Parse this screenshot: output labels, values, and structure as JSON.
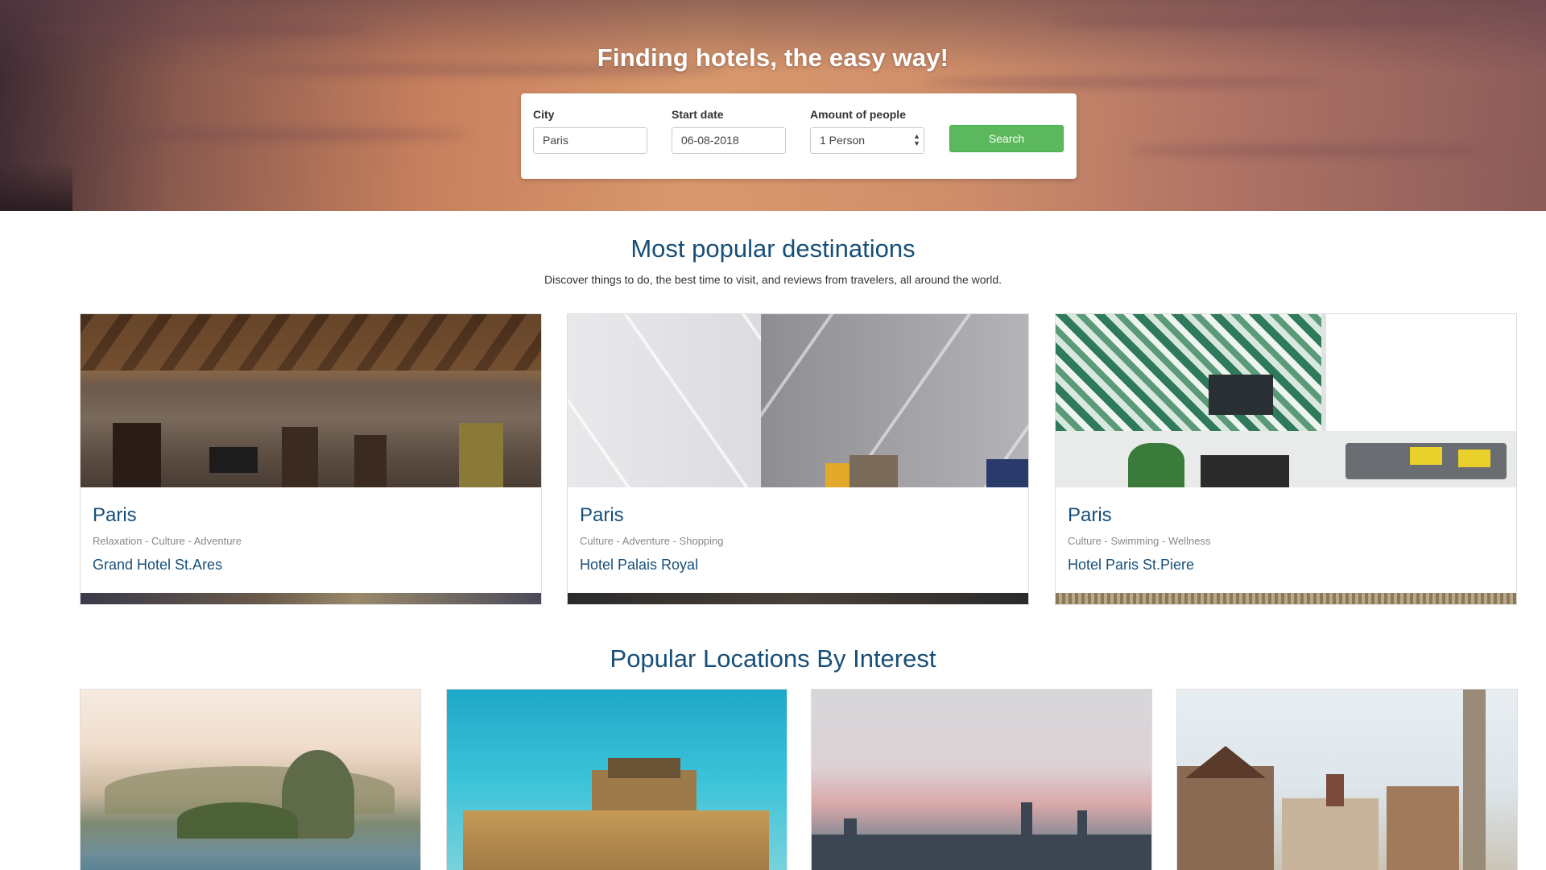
{
  "hero": {
    "title": "Finding hotels, the easy way!",
    "search": {
      "city_label": "City",
      "city_value": "Paris",
      "date_label": "Start date",
      "date_value": "06-08-2018",
      "people_label": "Amount of people",
      "people_value": "1 Person",
      "button_label": "Search"
    }
  },
  "popular": {
    "title": "Most popular destinations",
    "subtitle": "Discover things to do, the best time to visit, and reviews from travelers, all around the world.",
    "cards": [
      {
        "city": "Paris",
        "tags": "Relaxation - Culture - Adventure",
        "hotel": "Grand Hotel St.Ares"
      },
      {
        "city": "Paris",
        "tags": "Culture - Adventure - Shopping",
        "hotel": "Hotel Palais Royal"
      },
      {
        "city": "Paris",
        "tags": "Culture - Swimming - Wellness",
        "hotel": "Hotel Paris St.Piere"
      }
    ]
  },
  "interest": {
    "title": "Popular Locations By Interest"
  },
  "colors": {
    "accent": "#174f78",
    "search_button": "#5cb85c"
  }
}
